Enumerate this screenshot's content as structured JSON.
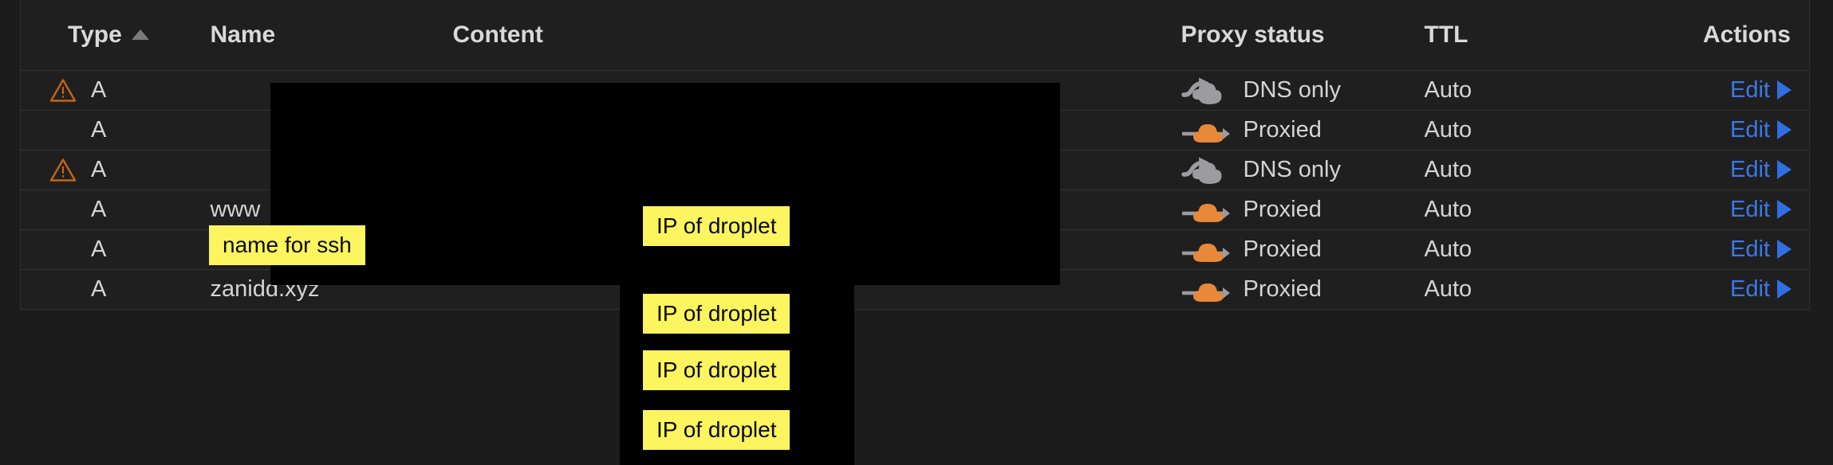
{
  "table": {
    "columns": [
      {
        "key": "type",
        "label": "Type",
        "sorted": true,
        "sort_dir": "asc",
        "sort_icon": "caret-up-icon"
      },
      {
        "key": "name",
        "label": "Name",
        "sorted": false
      },
      {
        "key": "content",
        "label": "Content",
        "sorted": false
      },
      {
        "key": "proxy",
        "label": "Proxy status",
        "sorted": false
      },
      {
        "key": "ttl",
        "label": "TTL",
        "sorted": false
      },
      {
        "key": "actions",
        "label": "Actions",
        "sorted": false
      }
    ],
    "rows": [
      {
        "warning": true,
        "warning_icon": "warning-triangle-icon",
        "type": "A",
        "name": "",
        "content": "",
        "proxy_status": "DNS only",
        "proxy_icon": "cloud-dns-only-icon",
        "ttl": "Auto",
        "action": "Edit",
        "action_icon": "caret-right-icon"
      },
      {
        "warning": false,
        "warning_icon": "",
        "type": "A",
        "name": "",
        "content": "",
        "proxy_status": "Proxied",
        "proxy_icon": "cloud-proxied-icon",
        "ttl": "Auto",
        "action": "Edit",
        "action_icon": "caret-right-icon"
      },
      {
        "warning": true,
        "warning_icon": "warning-triangle-icon",
        "type": "A",
        "name": "",
        "content": "",
        "proxy_status": "DNS only",
        "proxy_icon": "cloud-dns-only-icon",
        "ttl": "Auto",
        "action": "Edit",
        "action_icon": "caret-right-icon"
      },
      {
        "warning": false,
        "warning_icon": "",
        "type": "A",
        "name": "www",
        "content": "",
        "proxy_status": "Proxied",
        "proxy_icon": "cloud-proxied-icon",
        "ttl": "Auto",
        "action": "Edit",
        "action_icon": "caret-right-icon"
      },
      {
        "warning": false,
        "warning_icon": "",
        "type": "A",
        "name": "*",
        "content": "",
        "proxy_status": "Proxied",
        "proxy_icon": "cloud-proxied-icon",
        "ttl": "Auto",
        "action": "Edit",
        "action_icon": "caret-right-icon"
      },
      {
        "warning": false,
        "warning_icon": "",
        "type": "A",
        "name": "zanidd.xyz",
        "content": "",
        "proxy_status": "Proxied",
        "proxy_icon": "cloud-proxied-icon",
        "ttl": "Auto",
        "action": "Edit",
        "action_icon": "caret-right-icon"
      }
    ]
  },
  "annotations": {
    "ssh_name": "name for ssh",
    "ip_1": "IP of droplet",
    "ip_2": "IP of droplet",
    "ip_3": "IP of droplet",
    "ip_4": "IP of droplet"
  },
  "colors": {
    "page_background": "#1c1c1c",
    "row_background": "#1f1f1f",
    "row_divider": "#343434",
    "text_primary": "#d4d4d4",
    "header_text": "#d9d9d9",
    "warning_orange": "#c3651b",
    "proxied_orange": "#e8883a",
    "dns_only_gray": "#9b9ba0",
    "link_blue": "#3b78e7",
    "annotation_yellow": "#fcf55f",
    "redaction_black": "#000000"
  }
}
